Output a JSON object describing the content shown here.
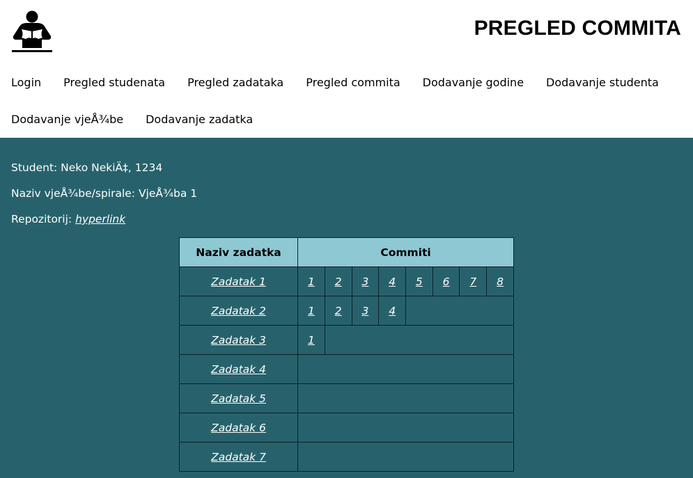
{
  "header": {
    "title": "PREGLED COMMITA",
    "logo_icon": "person-reading-icon"
  },
  "nav": [
    "Login",
    "Pregled studenata",
    "Pregled zadataka",
    "Pregled commita",
    "Dodavanje godine",
    "Dodavanje studenta",
    "Dodavanje vjeÅ¾be",
    "Dodavanje zadatka"
  ],
  "info": {
    "student": "Student: Neko NekiÄ‡, 1234",
    "naziv": "Naziv vjeÅ¾be/spirale: VjeÅ¾ba 1",
    "repo_label": "Repozitorij: ",
    "repo_link": "hyperlink"
  },
  "table": {
    "headers": [
      "Naziv zadatka",
      "Commiti"
    ],
    "rows": [
      {
        "name": "Zadatak 1",
        "commits": [
          "1",
          "2",
          "3",
          "4",
          "5",
          "6",
          "7",
          "8"
        ]
      },
      {
        "name": "Zadatak 2",
        "commits": [
          "1",
          "2",
          "3",
          "4"
        ]
      },
      {
        "name": "Zadatak 3",
        "commits": [
          "1"
        ]
      },
      {
        "name": "Zadatak 4",
        "commits": []
      },
      {
        "name": "Zadatak 5",
        "commits": []
      },
      {
        "name": "Zadatak 6",
        "commits": []
      },
      {
        "name": "Zadatak 7",
        "commits": []
      }
    ]
  }
}
